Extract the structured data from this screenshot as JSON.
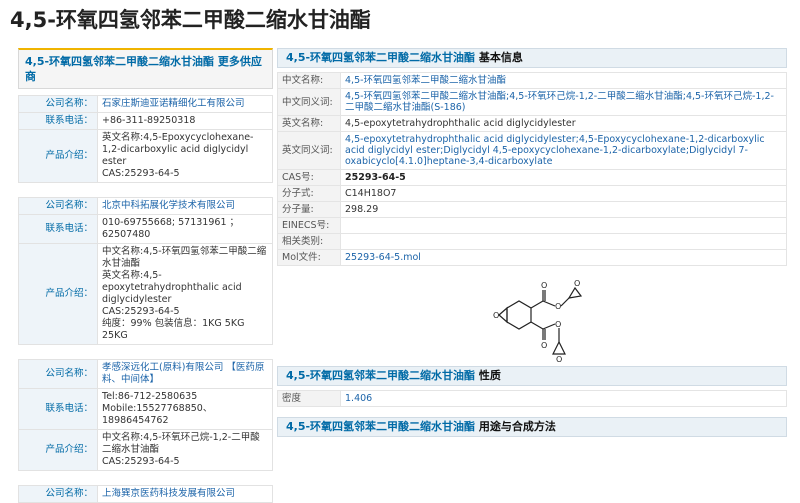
{
  "page_title": "4,5-环氧四氢邻苯二甲酸二缩水甘油酯",
  "left_header": "4,5-环氧四氢邻苯二甲酸二缩水甘油酯  更多供应商",
  "labels": {
    "company": "公司名称：",
    "phone": "联系电话：",
    "product": "产品介绍："
  },
  "suppliers": [
    {
      "company": "石家庄斯迪亚诺精细化工有限公司",
      "phone": [
        "+86-311-89250318"
      ],
      "product": [
        "英文名称:4,5-Epoxycyclohexane-1,2-dicarboxylic acid diglycidyl ester",
        "CAS:25293-64-5"
      ]
    },
    {
      "company": "北京中科拓展化学技术有限公司",
      "phone": [
        "010-69755668; 57131961 ；",
        "62507480"
      ],
      "product": [
        "中文名称:4,5-环氧四氢邻苯二甲酸二缩水甘油酯",
        "英文名称:4,5-epoxytetrahydrophthalic acid diglycidylester",
        "CAS:25293-64-5",
        "纯度：99% 包装信息：1KG 5KG 25KG"
      ]
    },
    {
      "company": "孝感深远化工(原料)有限公司 【医药原料、中间体】",
      "phone": [
        "Tel:86-712-2580635",
        "Mobile:15527768850、 18986454762"
      ],
      "product": [
        "中文名称:4,5-环氧环己烷-1,2-二甲酸二缩水甘油酯",
        "CAS:25293-64-5"
      ]
    },
    {
      "company": "上海巽京医药科技发展有限公司"
    }
  ],
  "basic": {
    "header_name": "4,5-环氧四氢邻苯二甲酸二缩水甘油酯",
    "header_suffix": "基本信息",
    "rows": [
      {
        "k": "中文名称:",
        "v": "4,5-环氧四氢邻苯二甲酸二缩水甘油酯",
        "link": true
      },
      {
        "k": "中文同义词:",
        "v": "4,5-环氧四氢邻苯二甲酸二缩水甘油酯;4,5-环氧环己烷-1,2-二甲酸二缩水甘油酯;4,5-环氧环己烷-1,2-二甲酸二缩水甘油酯(S-186)",
        "link": true
      },
      {
        "k": "英文名称:",
        "v": "4,5-epoxytetrahydrophthalic acid diglycidylester",
        "link": false
      },
      {
        "k": "英文同义词:",
        "v": "4,5-epoxytetrahydrophthalic acid diglycidylester;4,5-Epoxycyclohexane-1,2-dicarboxylic acid diglycidyl ester;Diglycidyl 4,5-epoxycyclohexane-1,2-dicarboxylate;Diglycidyl 7-oxabicyclo[4.1.0]heptane-3,4-dicarboxylate",
        "link": true
      },
      {
        "k": "CAS号:",
        "v": "25293-64-5",
        "bold": true
      },
      {
        "k": "分子式:",
        "v": "C14H18O7",
        "link": false
      },
      {
        "k": "分子量:",
        "v": "298.29",
        "link": false
      },
      {
        "k": "EINECS号:",
        "v": "",
        "link": false
      },
      {
        "k": "相关类别:",
        "v": "",
        "link": false
      },
      {
        "k": "Mol文件:",
        "v": "25293-64-5.mol",
        "link": true
      }
    ]
  },
  "props": {
    "header_name": "4,5-环氧四氢邻苯二甲酸二缩水甘油酯",
    "header_suffix": "性质",
    "rows": [
      {
        "k": "密度",
        "v": "1.406"
      }
    ]
  },
  "usage": {
    "header_name": "4,5-环氧四氢邻苯二甲酸二缩水甘油酯",
    "header_suffix": "用途与合成方法"
  },
  "colors": {
    "link": "#1c64a9",
    "accent": "#f0b400",
    "header_bg": "#eaf1f6"
  }
}
